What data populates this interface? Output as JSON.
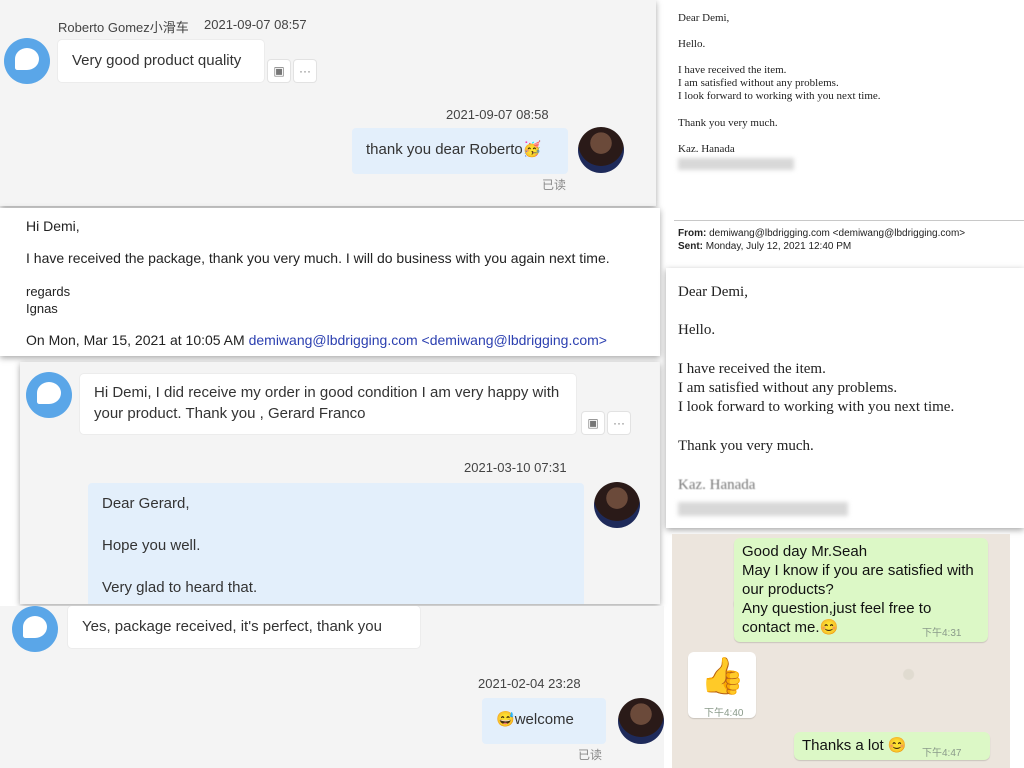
{
  "chat1": {
    "sender": "Roberto Gomez小滑车",
    "sender_time": "2021-09-07 08:57",
    "incoming": "Very good product quality",
    "reply_time": "2021-09-07 08:58",
    "reply": "thank you dear Roberto",
    "read_status": "已读"
  },
  "email1": {
    "greeting": "Hi Demi,",
    "body": "I have received the package, thank you very much. I will do business with you again next time.",
    "signoff": "regards",
    "name": "Ignas",
    "quote_prefix": "On Mon, Mar 15, 2021 at 10:05 AM",
    "email": "demiwang@lbdrigging.com",
    "email_bracketed": "<demiwang@lbdrigging.com>"
  },
  "chat2": {
    "incoming": "Hi Demi, I did receive my order in good condition I am very happy with your product. Thank you , Gerard Franco",
    "reply_time": "2021-03-10 07:31",
    "reply_line1": "Dear Gerard,",
    "reply_line2": "Hope you well.",
    "reply_line3": "Very glad to heard that."
  },
  "chat3": {
    "incoming": "Yes, package received, it's perfect, thank you",
    "reply_time": "2021-02-04 23:28",
    "reply": "welcome",
    "read_status": "已读"
  },
  "email2": {
    "greeting": "Dear Demi,",
    "hello": "Hello.",
    "line1": "I have received the item.",
    "line2": "I am satisfied without any problems.",
    "line3": "I look forward to working with you next time.",
    "thanks": "Thank you very much.",
    "name": "Kaz. Hanada",
    "from_label": "From:",
    "from_value": "demiwang@lbdrigging.com <demiwang@lbdrigging.com>",
    "sent_label": "Sent:",
    "sent_value": "Monday, July 12, 2021 12:40 PM"
  },
  "email3": {
    "greeting": "Dear Demi,",
    "hello": "Hello.",
    "line1": "I have received the item.",
    "line2": "I am satisfied without any problems.",
    "line3": "I look forward to working with you next time.",
    "thanks": "Thank you very much.",
    "name": "Kaz. Hanada"
  },
  "whatsapp": {
    "msg1_line1": "Good day Mr.Seah",
    "msg1_line2": "May I know if you are satisfied with our products?",
    "msg1_line3": "Any question,just feel free to contact me.",
    "msg1_time": "下午4:31",
    "thumb_time": "下午4:40",
    "msg2": "Thanks a lot",
    "msg2_time": "下午4:47"
  },
  "icons": {
    "avatar": "chat-bubble-avatar",
    "emoji_party": "🥳",
    "emoji_sweat": "😅",
    "emoji_smile": "😊",
    "emoji_thumb": "👍"
  },
  "colors": {
    "avatar_blue": "#5aa6e8",
    "reply_bg": "#e3effb",
    "wa_bubble": "#dcf8c6",
    "link": "#2b3fb0"
  }
}
